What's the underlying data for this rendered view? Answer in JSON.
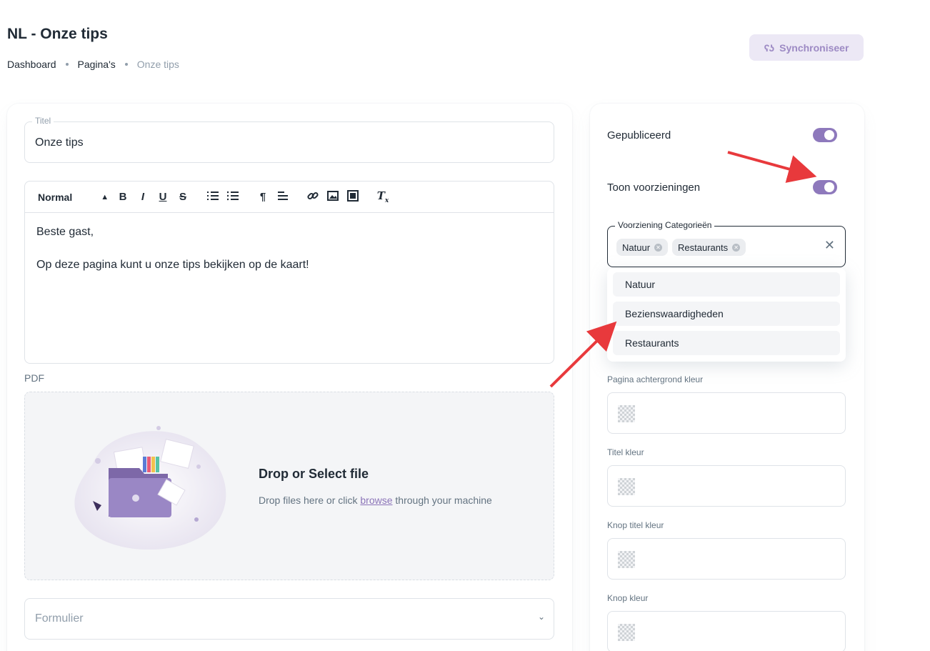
{
  "header": {
    "title": "NL - Onze tips",
    "breadcrumbs": [
      "Dashboard",
      "Pagina's",
      "Onze tips"
    ],
    "sync_button": {
      "icon": "sync-icon",
      "label": "Synchroniseer"
    }
  },
  "form": {
    "title_field": {
      "legend": "Titel",
      "value": "Onze tips"
    },
    "editor": {
      "format_select": "Normal",
      "toolbar_icons": [
        "bold-icon",
        "italic-icon",
        "underline-icon",
        "strikethrough-icon",
        "ordered-list-icon",
        "bullet-list-icon",
        "text-direction-icon",
        "align-icon",
        "link-icon",
        "image-icon",
        "video-icon",
        "clear-format-icon"
      ],
      "toolbar_glyphs": {
        "bold": "B",
        "italic": "I",
        "underline": "U",
        "strike": "S"
      },
      "paragraphs": [
        "Beste gast,",
        "Op deze pagina kunt u onze tips bekijken op de kaart!"
      ]
    },
    "pdf": {
      "label": "PDF",
      "dropzone_title": "Drop or Select file",
      "dropzone_text_before": "Drop files here or click ",
      "dropzone_link": "browse",
      "dropzone_text_after": " through your machine"
    },
    "form_select": {
      "placeholder": "Formulier"
    }
  },
  "sidebar": {
    "published": {
      "label": "Gepubliceerd",
      "on": true
    },
    "show_facilities": {
      "label": "Toon voorzieningen",
      "on": true
    },
    "categories": {
      "legend": "Voorziening Categorieën",
      "selected": [
        "Natuur",
        "Restaurants"
      ],
      "options": [
        "Natuur",
        "Bezienswaardigheden",
        "Restaurants"
      ]
    },
    "colors": [
      {
        "label": "Pagina achtergrond kleur"
      },
      {
        "label": "Titel kleur"
      },
      {
        "label": "Knop titel kleur"
      },
      {
        "label": "Knop kleur"
      }
    ]
  },
  "theme": {
    "accent": "#8e79bc",
    "annotation_arrow": "#e8393c"
  }
}
